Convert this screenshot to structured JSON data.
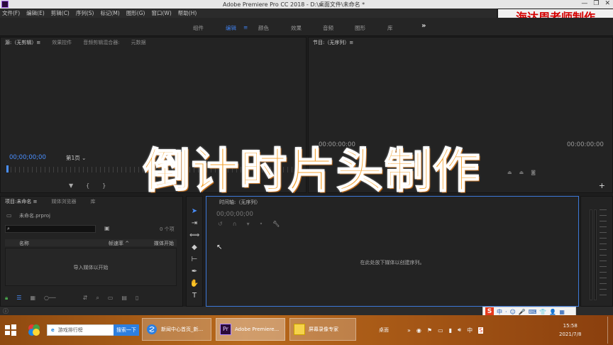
{
  "window": {
    "title": "Adobe Premiere Pro CC 2018 - D:\\桌面文件\\未命名 *",
    "controls": [
      "—",
      "❐",
      "✕"
    ]
  },
  "menu": [
    "文件(F)",
    "编辑(E)",
    "剪辑(C)",
    "序列(S)",
    "标记(M)",
    "图形(G)",
    "窗口(W)",
    "帮助(H)"
  ],
  "author_overlay": "海达周老师制作",
  "workspaces": {
    "items": [
      "组件",
      "编辑",
      "颜色",
      "效果",
      "音频",
      "图形",
      "库"
    ],
    "active": "编辑",
    "more_icon": "»"
  },
  "source_panel": {
    "tabs": [
      "源:（无剪辑）≡",
      "效果控件",
      "音频剪辑混合器:",
      "元数据"
    ],
    "timecode": "00;00;00;00",
    "page_select": "第1页",
    "transport_icons": [
      "marker-icon",
      "in-point-icon",
      "out-point-icon"
    ]
  },
  "program_panel": {
    "tabs": [
      "节目:（无序列）≡"
    ],
    "timecode_left": "00:00:00:00",
    "timecode_right": "00:00:00:00",
    "add_icon": "+"
  },
  "project_panel": {
    "tabs": [
      "项目:未命名 ≡",
      "媒体浏览器",
      "库"
    ],
    "file": "未命名.prproj",
    "item_count": "0 个项",
    "columns": [
      "名称",
      "帧速率 ^",
      "媒体开始"
    ],
    "empty_hint": "导入媒体以开始"
  },
  "timeline_panel": {
    "tab": "时间轴:（无序列）",
    "timecode": "00;00;00;00",
    "empty_hint": "在此处放下媒体以创建序列。"
  },
  "headline": "倒计时片头制作",
  "ime": {
    "logo": "S",
    "label": "中",
    "icons": [
      "·",
      "☺",
      "🎤",
      "⌨",
      "👕",
      "👤",
      "▦"
    ]
  },
  "taskbar": {
    "search_text": "游戏排行榜",
    "search_button": "搜索一下",
    "buttons": [
      {
        "label": "新闻中心首页_新..."
      },
      {
        "label": "Adobe Premiere..."
      },
      {
        "label": "屏幕录像专家"
      }
    ],
    "tray_label": "桌面",
    "clock_time": "15:58",
    "clock_date": "2021/7/8"
  }
}
